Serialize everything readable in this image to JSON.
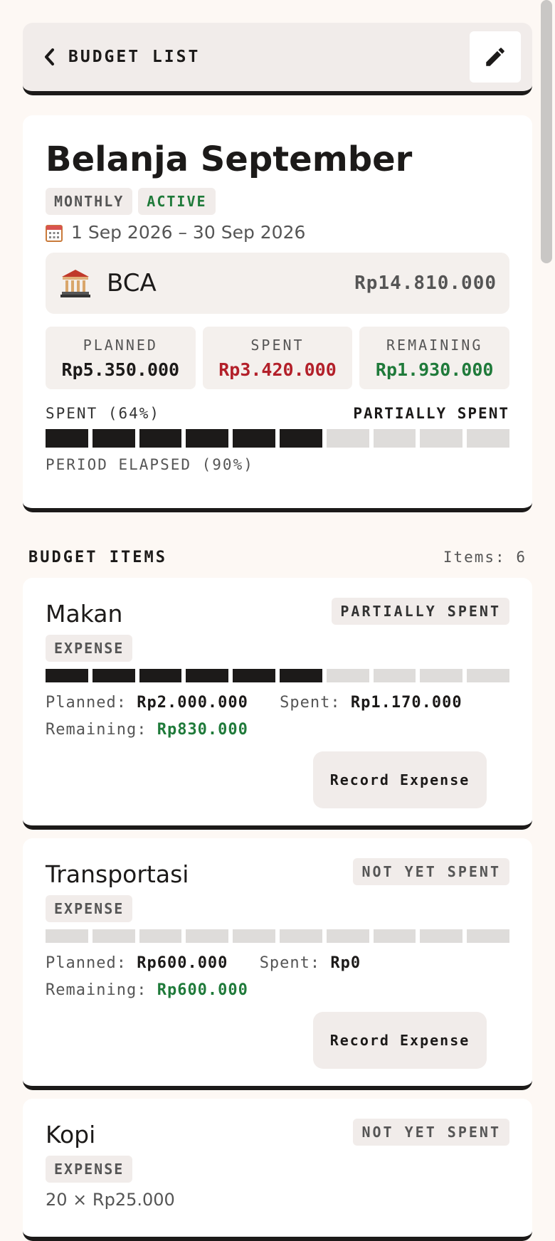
{
  "header": {
    "back_label": "BUDGET LIST"
  },
  "budget": {
    "title": "Belanja September",
    "period_badge": "MONTHLY",
    "status_badge": "ACTIVE",
    "date_range": "1 Sep 2026 – 30 Sep 2026",
    "account": {
      "name": "BCA",
      "balance": "Rp14.810.000"
    },
    "stats": {
      "planned_label": "PLANNED",
      "planned_value": "Rp5.350.000",
      "spent_label": "SPENT",
      "spent_value": "Rp3.420.000",
      "remaining_label": "REMAINING",
      "remaining_value": "Rp1.930.000"
    },
    "spent_label": "SPENT (64%)",
    "spent_status": "PARTIALLY SPENT",
    "spent_progress": 0.6,
    "elapsed_label": "PERIOD ELAPSED (90%)"
  },
  "items_section": {
    "title": "BUDGET ITEMS",
    "count": "Items: 6"
  },
  "items": [
    {
      "name": "Makan",
      "status": "PARTIALLY SPENT",
      "type": "EXPENSE",
      "progress": 0.6,
      "planned_label": "Planned:",
      "planned": "Rp2.000.000",
      "spent_label": "Spent:",
      "spent": "Rp1.170.000",
      "remaining_label": "Remaining:",
      "remaining": "Rp830.000",
      "action": "Record Expense"
    },
    {
      "name": "Transportasi",
      "status": "NOT YET SPENT",
      "type": "EXPENSE",
      "progress": 0,
      "planned_label": "Planned:",
      "planned": "Rp600.000",
      "spent_label": "Spent:",
      "spent": "Rp0",
      "remaining_label": "Remaining:",
      "remaining": "Rp600.000",
      "action": "Record Expense"
    },
    {
      "name": "Kopi",
      "status": "NOT YET SPENT",
      "type": "EXPENSE",
      "sub": "20 × Rp25.000"
    }
  ],
  "colors": {
    "accent_dark": "#1c1a19",
    "positive": "#1f7a3a",
    "negative": "#b3202a",
    "background": "#fdf8f4"
  }
}
